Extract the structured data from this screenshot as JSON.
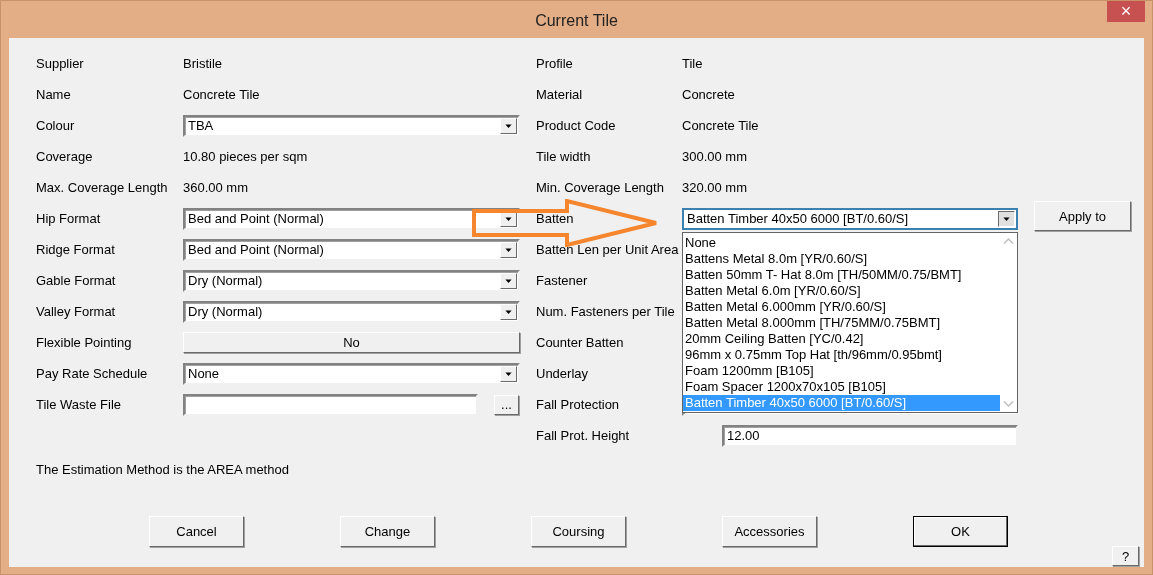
{
  "window": {
    "title": "Current Tile",
    "close_label": "×"
  },
  "left_rows": [
    {
      "label": "Supplier",
      "kind": "text",
      "value": "Bristile"
    },
    {
      "label": "Name",
      "kind": "text",
      "value": "Concrete Tile"
    },
    {
      "label": "Colour",
      "kind": "select",
      "value": "TBA"
    },
    {
      "label": "Coverage",
      "kind": "text",
      "value": "10.80 pieces per sqm"
    },
    {
      "label": "Max. Coverage Length",
      "kind": "text",
      "value": "360.00 mm"
    },
    {
      "label": "Hip Format",
      "kind": "select",
      "value": "Bed and Point (Normal)"
    },
    {
      "label": "Ridge Format",
      "kind": "select",
      "value": "Bed and Point (Normal)"
    },
    {
      "label": "Gable Format",
      "kind": "select",
      "value": "Dry (Normal)"
    },
    {
      "label": "Valley Format",
      "kind": "select",
      "value": "Dry (Normal)"
    },
    {
      "label": "Flexible Pointing",
      "kind": "button",
      "value": "No"
    },
    {
      "label": "Pay Rate Schedule",
      "kind": "select",
      "value": "None"
    },
    {
      "label": "Tile Waste File",
      "kind": "file",
      "browse_label": "..."
    }
  ],
  "right_rows": [
    {
      "label": "Profile",
      "kind": "text",
      "value": "Tile"
    },
    {
      "label": "Material",
      "kind": "text",
      "value": "Concrete"
    },
    {
      "label": "Product Code",
      "kind": "text",
      "value": "Concrete Tile"
    },
    {
      "label": "Tile width",
      "kind": "text",
      "value": "300.00 mm"
    },
    {
      "label": "Min. Coverage Length",
      "kind": "text",
      "value": "320.00 mm"
    },
    {
      "label": "Batten",
      "kind": "select",
      "value": "Batten Timber 40x50 6000 [BT/0.60/S]",
      "expanded": true,
      "options": [
        {
          "label": "None",
          "selected": false
        },
        {
          "label": "Battens Metal 8.0m [YR/0.60/S]",
          "selected": false
        },
        {
          "label": "Batten  50mm T- Hat 8.0m [TH/50MM/0.75/BMT]",
          "selected": false
        },
        {
          "label": "Batten Metal 6.0m [YR/0.60/S]",
          "selected": false
        },
        {
          "label": "Batten Metal 6.000mm [YR/0.60/S]",
          "selected": false
        },
        {
          "label": "Batten Metal 8.000mm [TH/75MM/0.75BMT]",
          "selected": false
        },
        {
          "label": "20mm Ceiling Batten [YC/0.42]",
          "selected": false
        },
        {
          "label": "96mm x 0.75mm Top Hat [th/96mm/0.95bmt]",
          "selected": false
        },
        {
          "label": "Foam 1200mm [B105]",
          "selected": false
        },
        {
          "label": "Foam Spacer 1200x70x105 [B105]",
          "selected": false
        },
        {
          "label": "Batten Timber 40x50 6000 [BT/0.60/S]",
          "selected": true
        }
      ]
    },
    {
      "label": "Batten Len per Unit Area",
      "kind": "covered"
    },
    {
      "label": "Fastener",
      "kind": "covered"
    },
    {
      "label": "Num. Fasteners per Tile",
      "kind": "covered"
    },
    {
      "label": "Counter Batten",
      "kind": "covered"
    },
    {
      "label": "Underlay",
      "kind": "covered"
    },
    {
      "label": "Fall Protection",
      "kind": "box"
    },
    {
      "label": "Fall Prot. Height",
      "kind": "field",
      "value": "12.00"
    }
  ],
  "apply_button": "Apply to",
  "note": "The Estimation Method is the AREA method",
  "buttons": [
    {
      "label": "Cancel",
      "default": false
    },
    {
      "label": "Change",
      "default": false
    },
    {
      "label": "Coursing",
      "default": false
    },
    {
      "label": "Accessories",
      "default": false
    },
    {
      "label": "OK",
      "default": true
    }
  ],
  "help_label": "?"
}
